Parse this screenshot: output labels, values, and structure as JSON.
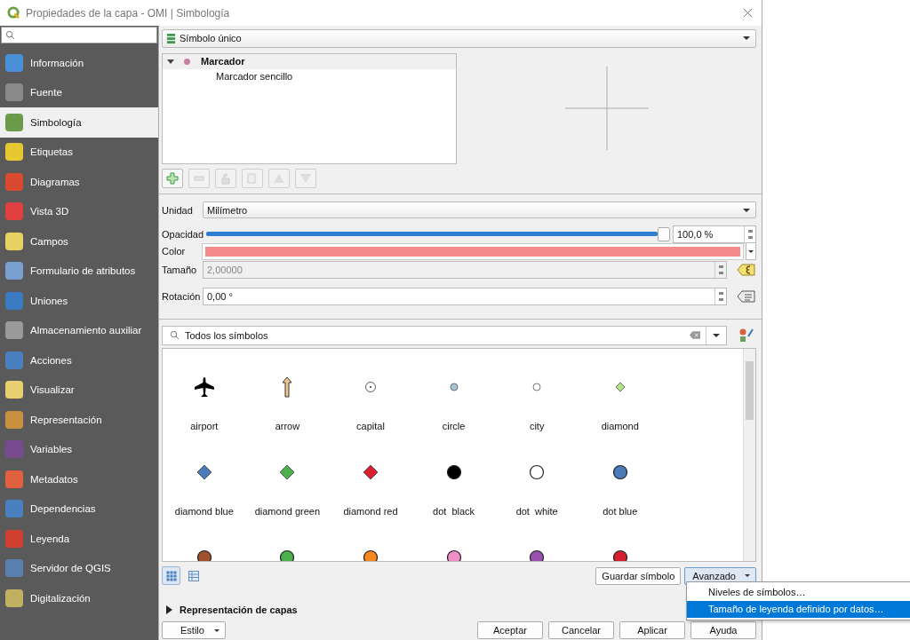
{
  "window": {
    "title": "Propiedades de la capa - OMI | Simbología"
  },
  "sidebar": {
    "items": [
      {
        "label": "Información",
        "selected": false
      },
      {
        "label": "Fuente",
        "selected": false
      },
      {
        "label": "Simbología",
        "selected": true
      },
      {
        "label": "Etiquetas",
        "selected": false
      },
      {
        "label": "Diagramas",
        "selected": false
      },
      {
        "label": "Vista 3D",
        "selected": false
      },
      {
        "label": "Campos",
        "selected": false
      },
      {
        "label": "Formulario de atributos",
        "selected": false
      },
      {
        "label": "Uniones",
        "selected": false
      },
      {
        "label": "Almacenamiento auxiliar",
        "selected": false
      },
      {
        "label": "Acciones",
        "selected": false
      },
      {
        "label": "Visualizar",
        "selected": false
      },
      {
        "label": "Representación",
        "selected": false
      },
      {
        "label": "Variables",
        "selected": false
      },
      {
        "label": "Metadatos",
        "selected": false
      },
      {
        "label": "Dependencias",
        "selected": false
      },
      {
        "label": "Leyenda",
        "selected": false
      },
      {
        "label": "Servidor de QGIS",
        "selected": false
      },
      {
        "label": "Digitalización",
        "selected": false
      }
    ]
  },
  "renderer": {
    "value": "Símbolo único"
  },
  "symbol_tree": [
    {
      "label": "Marcador",
      "color": "#c580a0",
      "expanded": true,
      "children": [
        {
          "label": "Marcador sencillo"
        }
      ]
    }
  ],
  "layer_tools": [
    {
      "kind": "add",
      "disabled": false
    },
    {
      "kind": "remove",
      "disabled": true
    },
    {
      "kind": "lock",
      "disabled": true
    },
    {
      "kind": "duplicate",
      "disabled": true
    },
    {
      "kind": "up",
      "disabled": true
    },
    {
      "kind": "down",
      "disabled": true
    }
  ],
  "properties": {
    "unit": {
      "label": "Unidad",
      "value": "Milímetro"
    },
    "opacity": {
      "label": "Opacidad",
      "level": 1,
      "reading": "100,0 %"
    },
    "color": {
      "label": "Color",
      "color": "#f58c8c"
    },
    "size": {
      "label": "Tamaño",
      "value": "2,00000",
      "disabled": true
    },
    "rotation": {
      "label": "Rotación",
      "value": "0,00 °",
      "disabled": false
    }
  },
  "library": {
    "search": {
      "value": "Todos los símbolos"
    },
    "symbols": [
      {
        "kind": "plane",
        "color": "#000000",
        "name": "airport"
      },
      {
        "kind": "arrow",
        "color": "#f5c58a",
        "name": "arrow"
      },
      {
        "kind": "target",
        "color": "#ffffff",
        "name": "capital"
      },
      {
        "kind": "small-circle",
        "color": "#a6c4d8",
        "name": "circle"
      },
      {
        "kind": "small-circle",
        "color": "#ffffff",
        "name": "city"
      },
      {
        "kind": "small-diamond",
        "color": "#b2df8a",
        "name": "diamond"
      },
      {
        "kind": "diamond",
        "color": "#4a7ab8",
        "name": "diamond blue"
      },
      {
        "kind": "diamond",
        "color": "#4cae4c",
        "name": "diamond green"
      },
      {
        "kind": "diamond",
        "color": "#d62030",
        "name": "diamond red"
      },
      {
        "kind": "circle",
        "color": "#000000",
        "name": "dot  black"
      },
      {
        "kind": "circle",
        "color": "#ffffff",
        "name": "dot  white"
      },
      {
        "kind": "circle",
        "color": "#4a7ab8",
        "name": "dot blue"
      },
      {
        "kind": "circle",
        "color": "#a0522d"
      },
      {
        "kind": "circle",
        "color": "#4cae4c"
      },
      {
        "kind": "circle",
        "color": "#f58820"
      },
      {
        "kind": "circle",
        "color": "#f08cc8"
      },
      {
        "kind": "circle",
        "color": "#9a50b0"
      },
      {
        "kind": "circle",
        "color": "#d62030"
      }
    ]
  },
  "view_modes": [
    {
      "kind": "grid",
      "selected": true
    },
    {
      "kind": "list",
      "selected": false
    }
  ],
  "save_button": "Guardar símbolo",
  "advanced_button": "Avanzado",
  "advanced_menu": [
    {
      "label": "Niveles de símbolos…",
      "selected": false
    },
    {
      "label": "Tamaño de leyenda definido por datos…",
      "selected": true
    }
  ],
  "layer_rendering": {
    "label": "Representación de capas",
    "expanded": false
  },
  "style_button": "Estilo",
  "buttons": [
    "Aceptar",
    "Cancelar",
    "Aplicar",
    "Ayuda"
  ]
}
